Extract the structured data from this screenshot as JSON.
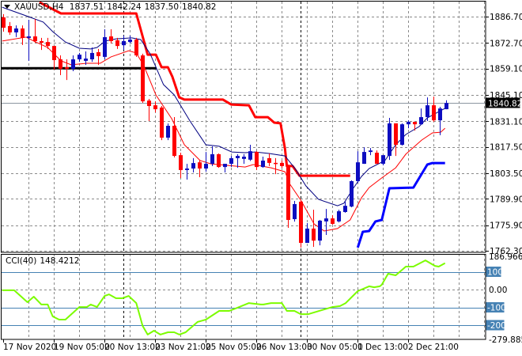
{
  "header": {
    "symbol": "XAUUSD,H4",
    "open": "1837.51",
    "high": "1842.24",
    "low": "1837.50",
    "close": "1840.82"
  },
  "cci_label": {
    "name": "CCI(40)",
    "value": "148.4212"
  },
  "colors": {
    "bull": "#0d0dc0",
    "bear": "#ff0000",
    "ma_slow": "#000080",
    "ma_fast": "#ff0000",
    "stop_red": "#ff0000",
    "stop_blue": "#0000ff",
    "cci": "#7cfc00",
    "level": "#4682b4",
    "grid": "#8a8a8a"
  },
  "chart_data": [
    {
      "type": "candlestick",
      "title": "XAUUSD,H4",
      "ylim": [
        1762.3,
        1886.7
      ],
      "price_ticks": [
        "1886.70",
        "1872.70",
        "1859.10",
        "1845.10",
        "1831.10",
        "1817.50",
        "1803.50",
        "1789.90",
        "1775.90",
        "1762.30"
      ],
      "current_price": "1840.82",
      "candles": [
        [
          1886.3,
          1888,
          1878.7,
          1880.8
        ],
        [
          1881.7,
          1883.8,
          1877,
          1878.3
        ],
        [
          1878.3,
          1882,
          1875.8,
          1880.4
        ],
        [
          1880.4,
          1882,
          1871.6,
          1875.4
        ],
        [
          1875.4,
          1885,
          1863.2,
          1876.2
        ],
        [
          1876.2,
          1885.4,
          1872.8,
          1873.7
        ],
        [
          1873.7,
          1875.4,
          1869,
          1872.8
        ],
        [
          1873.2,
          1875.4,
          1869.5,
          1871.1
        ],
        [
          1871.1,
          1871.1,
          1858.5,
          1863.6
        ],
        [
          1864,
          1866.1,
          1855.6,
          1859
        ],
        [
          1859.8,
          1864,
          1853,
          1859
        ],
        [
          1859,
          1866.1,
          1857.7,
          1864
        ],
        [
          1864,
          1867.4,
          1862.7,
          1866.5
        ],
        [
          1863.2,
          1868.2,
          1861,
          1864.4
        ],
        [
          1864,
          1870.3,
          1862.7,
          1867.4
        ],
        [
          1867.8,
          1869.5,
          1861,
          1865.7
        ],
        [
          1865.3,
          1880,
          1864,
          1875.8
        ],
        [
          1876.2,
          1880,
          1872.4,
          1873.7
        ],
        [
          1874.1,
          1875.4,
          1869.5,
          1871.1
        ],
        [
          1871.5,
          1876.6,
          1869,
          1873.7
        ],
        [
          1873.2,
          1876.6,
          1872.4,
          1874.5
        ],
        [
          1874.5,
          1875.4,
          1865.3,
          1866.1
        ],
        [
          1866.1,
          1867,
          1840.9,
          1841.7
        ],
        [
          1842.1,
          1843,
          1831.2,
          1839.2
        ],
        [
          1839.6,
          1841.7,
          1835.8,
          1837.5
        ],
        [
          1838.4,
          1839.2,
          1821.1,
          1822.4
        ],
        [
          1822.4,
          1829.9,
          1821.1,
          1828.7
        ],
        [
          1828.7,
          1833.3,
          1811.9,
          1812.7
        ],
        [
          1813.1,
          1814.4,
          1800.9,
          1805.2
        ],
        [
          1805.2,
          1808.5,
          1800.1,
          1806
        ],
        [
          1806,
          1811.5,
          1803.9,
          1808.9
        ],
        [
          1809.3,
          1810.2,
          1801.4,
          1806
        ],
        [
          1806,
          1814.8,
          1804.3,
          1808.5
        ],
        [
          1808.5,
          1817.8,
          1807.3,
          1813.6
        ],
        [
          1813.6,
          1814,
          1806.4,
          1806.8
        ],
        [
          1806.8,
          1808.5,
          1803.9,
          1808.5
        ],
        [
          1808.5,
          1812.7,
          1806.8,
          1811.5
        ],
        [
          1811.5,
          1813.6,
          1806.4,
          1812.7
        ],
        [
          1811.1,
          1813.6,
          1808.5,
          1812.3
        ],
        [
          1810.7,
          1818.6,
          1810,
          1815.2
        ],
        [
          1814.8,
          1815.2,
          1805.2,
          1806.8
        ],
        [
          1806.8,
          1812.3,
          1806.4,
          1810.2
        ],
        [
          1811.5,
          1814,
          1807.3,
          1809
        ],
        [
          1809,
          1811.5,
          1803,
          1808.5
        ],
        [
          1809,
          1810.2,
          1806.4,
          1807.3
        ],
        [
          1807.7,
          1808.1,
          1774.5,
          1778.7
        ],
        [
          1779.1,
          1788.8,
          1777.8,
          1787.1
        ],
        [
          1788.4,
          1788.8,
          1764,
          1766.5
        ],
        [
          1766.5,
          1777,
          1766.5,
          1774.1
        ],
        [
          1774.1,
          1784.1,
          1764.4,
          1767.7
        ],
        [
          1767.7,
          1778.7,
          1765.2,
          1778.3
        ],
        [
          1777.9,
          1784.5,
          1770.7,
          1779.5
        ],
        [
          1779.5,
          1781.2,
          1776.2,
          1776.6
        ],
        [
          1777.9,
          1784.1,
          1777.4,
          1783.3
        ],
        [
          1782.9,
          1788.4,
          1782.5,
          1786.2
        ],
        [
          1785.8,
          1799.7,
          1785.4,
          1799.3
        ],
        [
          1799.3,
          1815.2,
          1798.4,
          1809.3
        ],
        [
          1808.5,
          1817.3,
          1808.5,
          1814.8
        ],
        [
          1814.8,
          1816.9,
          1813.1,
          1815.6
        ],
        [
          1814.4,
          1815.6,
          1808.5,
          1808.5
        ],
        [
          1808.5,
          1813.1,
          1807.7,
          1813.1
        ],
        [
          1812.7,
          1832.9,
          1810.6,
          1830
        ],
        [
          1830,
          1830,
          1812.7,
          1818.6
        ],
        [
          1818.6,
          1830,
          1818.2,
          1829.5
        ],
        [
          1829.5,
          1831.6,
          1827.4,
          1830.8
        ],
        [
          1830.8,
          1830.8,
          1826.2,
          1829.5
        ],
        [
          1829.5,
          1837.9,
          1829.1,
          1833.3
        ],
        [
          1833.3,
          1843.8,
          1831.2,
          1839.6
        ],
        [
          1839.6,
          1844.2,
          1830.8,
          1831.6
        ],
        [
          1831.6,
          1838.8,
          1823.7,
          1837.9
        ],
        [
          1837.51,
          1842.24,
          1837.5,
          1840.82
        ]
      ],
      "ma_slow": [
        [
          -0.1,
          1891.7
        ],
        [
          3.7,
          1887.1
        ],
        [
          6.4,
          1883.8
        ],
        [
          7.9,
          1878.7
        ],
        [
          9.9,
          1873.2
        ],
        [
          12.1,
          1869.9
        ],
        [
          13.9,
          1869.5
        ],
        [
          14.9,
          1870.3
        ],
        [
          16.2,
          1873.7
        ],
        [
          17.9,
          1874.9
        ],
        [
          20.4,
          1875.4
        ],
        [
          21.8,
          1874.5
        ],
        [
          23.3,
          1866.9
        ],
        [
          25.4,
          1850.6
        ],
        [
          27.1,
          1845.1
        ],
        [
          29.6,
          1831.2
        ],
        [
          32.1,
          1818.6
        ],
        [
          34.2,
          1817.8
        ],
        [
          36.2,
          1814.8
        ],
        [
          38.3,
          1814.4
        ],
        [
          39.9,
          1814.8
        ],
        [
          42.1,
          1814
        ],
        [
          44.6,
          1812.7
        ],
        [
          46.2,
          1806
        ],
        [
          47.9,
          1796.8
        ],
        [
          49.9,
          1789.6
        ],
        [
          52.9,
          1786.2
        ],
        [
          53.9,
          1787.5
        ],
        [
          55.4,
          1795.5
        ],
        [
          56.7,
          1801.8
        ],
        [
          57.9,
          1806
        ],
        [
          60.4,
          1810.2
        ],
        [
          62.1,
          1818.6
        ],
        [
          63.7,
          1824.1
        ],
        [
          65.8,
          1828.3
        ],
        [
          67.1,
          1832.9
        ],
        [
          68.7,
          1835.8
        ],
        [
          69.9,
          1838
        ]
      ],
      "ma_fast": [
        [
          -0.1,
          1873.7
        ],
        [
          3.7,
          1875.8
        ],
        [
          4.9,
          1873.7
        ],
        [
          7.1,
          1870.3
        ],
        [
          9.2,
          1863.2
        ],
        [
          10.8,
          1861.1
        ],
        [
          13.3,
          1861.9
        ],
        [
          15.4,
          1861.9
        ],
        [
          17.1,
          1865.3
        ],
        [
          19.9,
          1868.6
        ],
        [
          21.1,
          1867.4
        ],
        [
          22.3,
          1860.6
        ],
        [
          24.2,
          1845.1
        ],
        [
          26.7,
          1832.5
        ],
        [
          28.7,
          1818.6
        ],
        [
          31.2,
          1810.2
        ],
        [
          32.9,
          1808.5
        ],
        [
          38.3,
          1806.8
        ],
        [
          39.6,
          1808.1
        ],
        [
          42.4,
          1806.4
        ],
        [
          44.6,
          1804.3
        ],
        [
          45.4,
          1797.6
        ],
        [
          47.1,
          1789.2
        ],
        [
          49.2,
          1776.6
        ],
        [
          50.8,
          1772.8
        ],
        [
          52.9,
          1774.1
        ],
        [
          54.9,
          1778.7
        ],
        [
          56.7,
          1790.5
        ],
        [
          57.9,
          1795.9
        ],
        [
          59.9,
          1801
        ],
        [
          62.1,
          1806.4
        ],
        [
          63.7,
          1813.6
        ],
        [
          66.2,
          1821.1
        ],
        [
          67.9,
          1824.9
        ],
        [
          69.2,
          1825.3
        ],
        [
          69.9,
          1827.4
        ]
      ],
      "stop_red": [
        [
          5.8,
          1894.3
        ],
        [
          9.2,
          1888.4
        ],
        [
          21.1,
          1888.4
        ],
        [
          22.9,
          1866.5
        ],
        [
          24.2,
          1866.5
        ],
        [
          25.1,
          1859.8
        ],
        [
          26.1,
          1859.8
        ],
        [
          26.8,
          1854.8
        ],
        [
          27.9,
          1843.8
        ],
        [
          28.7,
          1842.6
        ],
        [
          34.8,
          1842.6
        ],
        [
          36.1,
          1840
        ],
        [
          38.9,
          1839.6
        ],
        [
          39.9,
          1833.3
        ],
        [
          41.9,
          1833.3
        ],
        [
          42.9,
          1830.4
        ],
        [
          43.9,
          1830
        ],
        [
          44.6,
          1816.5
        ],
        [
          44.9,
          1807.3
        ],
        [
          45.8,
          1807.3
        ],
        [
          46.9,
          1802.2
        ],
        [
          54.9,
          1802.2
        ]
      ],
      "stop_blue": [
        [
          56.1,
          1764
        ],
        [
          56.9,
          1772.4
        ],
        [
          57.9,
          1772.8
        ],
        [
          58.9,
          1777.9
        ],
        [
          59.9,
          1778.7
        ],
        [
          61.1,
          1795.5
        ],
        [
          64.9,
          1795.9
        ],
        [
          67.1,
          1808.1
        ],
        [
          67.9,
          1808.9
        ],
        [
          69.9,
          1808.9
        ]
      ],
      "support_line": {
        "price": 1859.3,
        "from_bar": -0.5,
        "to_bar": 24.3
      },
      "separators": [
        19,
        47
      ]
    },
    {
      "type": "line",
      "title": "CCI(40)",
      "ylim": [
        -279.8854,
        186.966
      ],
      "axis_labels": {
        "max": "186.966",
        "zero": "0.00",
        "min": "-279.8854"
      },
      "levels": [
        {
          "value": 100,
          "label": "100"
        },
        {
          "value": -100,
          "label": "-100"
        },
        {
          "value": -200,
          "label": "-200"
        }
      ],
      "points": [
        [
          -0.1,
          -4
        ],
        [
          1.8,
          -4
        ],
        [
          3.9,
          -71
        ],
        [
          4.9,
          -40
        ],
        [
          6.1,
          -84
        ],
        [
          7.1,
          -84
        ],
        [
          7.9,
          -151
        ],
        [
          8.9,
          -169
        ],
        [
          9.9,
          -169
        ],
        [
          12.1,
          -98
        ],
        [
          13.3,
          -98
        ],
        [
          13.9,
          -84
        ],
        [
          14.9,
          -98
        ],
        [
          16.1,
          -36
        ],
        [
          16.8,
          -27
        ],
        [
          17.9,
          -49
        ],
        [
          18.9,
          -49
        ],
        [
          19.9,
          -36
        ],
        [
          21.1,
          -76
        ],
        [
          22.1,
          -204
        ],
        [
          22.9,
          -253
        ],
        [
          23.9,
          -231
        ],
        [
          24.9,
          -253
        ],
        [
          26.1,
          -240
        ],
        [
          27.1,
          -240
        ],
        [
          27.9,
          -253
        ],
        [
          28.9,
          -240
        ],
        [
          30.8,
          -182
        ],
        [
          32.1,
          -169
        ],
        [
          34.2,
          -120
        ],
        [
          35.8,
          -120
        ],
        [
          37.1,
          -102
        ],
        [
          38.9,
          -76
        ],
        [
          40.8,
          -84
        ],
        [
          41.2,
          -84
        ],
        [
          42.4,
          -76
        ],
        [
          44.1,
          -76
        ],
        [
          44.9,
          -120
        ],
        [
          46.1,
          -120
        ],
        [
          47.1,
          -138
        ],
        [
          48.3,
          -138
        ],
        [
          50.4,
          -116
        ],
        [
          52.1,
          -98
        ],
        [
          53.3,
          -93
        ],
        [
          54.2,
          -76
        ],
        [
          56.1,
          -9
        ],
        [
          57.9,
          18
        ],
        [
          58.7,
          13
        ],
        [
          59.6,
          18
        ],
        [
          59.9,
          27
        ],
        [
          60.9,
          89
        ],
        [
          62.1,
          80
        ],
        [
          63.7,
          129
        ],
        [
          64.9,
          129
        ],
        [
          66.8,
          164
        ],
        [
          68.3,
          133
        ],
        [
          68.9,
          129
        ],
        [
          69.9,
          148.4
        ]
      ]
    }
  ],
  "time_axis": [
    {
      "bar": 0,
      "label": "17 Nov 2020"
    },
    {
      "bar": 8,
      "label": "19 Nov 05:00"
    },
    {
      "bar": 16,
      "label": "20 Nov 13:00"
    },
    {
      "bar": 24,
      "label": "23 Nov 21:00"
    },
    {
      "bar": 32,
      "label": "25 Nov 05:00"
    },
    {
      "bar": 40,
      "label": "26 Nov 13:00"
    },
    {
      "bar": 48,
      "label": "30 Nov 05:00"
    },
    {
      "bar": 56,
      "label": "1 Dec 13:00"
    },
    {
      "bar": 64,
      "label": "2 Dec 21:00"
    }
  ]
}
